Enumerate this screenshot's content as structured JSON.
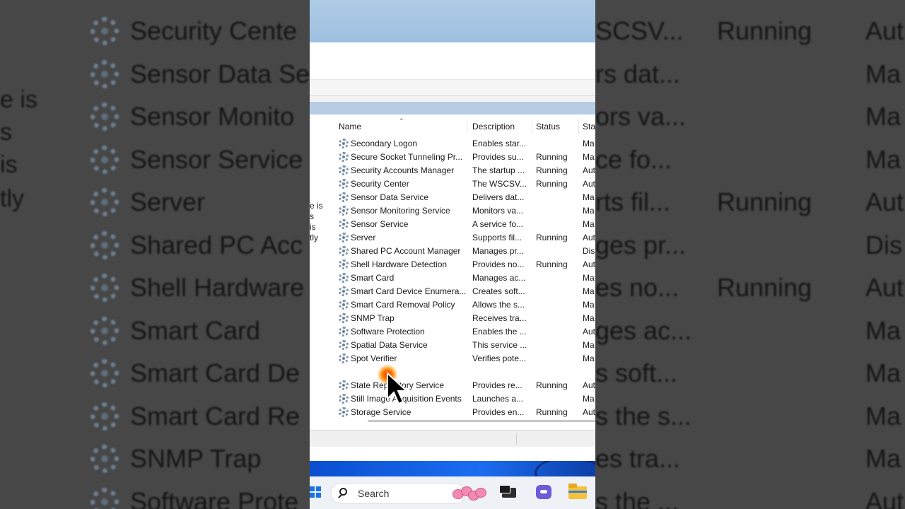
{
  "background": {
    "left_rows": [
      "Security Cente",
      "Sensor Data Se",
      "Sensor Monito",
      "Sensor Service",
      "Server",
      "Shared PC Acc",
      "Shell Hardware",
      "Smart Card",
      "Smart Card De",
      "Smart Card Re",
      "SNMP Trap",
      "Software Prote"
    ],
    "left_cut_texts": [
      "e is",
      "s",
      "is",
      "tly"
    ],
    "right_rows": [
      {
        "desc": "SCSV...",
        "status": "Running",
        "startup": "Aut"
      },
      {
        "desc": "rs dat...",
        "status": "",
        "startup": "Ma"
      },
      {
        "desc": "ors va...",
        "status": "",
        "startup": "Ma"
      },
      {
        "desc": "ce fo...",
        "status": "",
        "startup": "Ma"
      },
      {
        "desc": "rts fil...",
        "status": "Running",
        "startup": "Aut"
      },
      {
        "desc": "ges pr...",
        "status": "",
        "startup": "Dis"
      },
      {
        "desc": "es no...",
        "status": "Running",
        "startup": "Aut"
      },
      {
        "desc": "ges ac...",
        "status": "",
        "startup": "Ma"
      },
      {
        "desc": "s soft...",
        "status": "",
        "startup": "Ma"
      },
      {
        "desc": "s the s...",
        "status": "",
        "startup": "Ma"
      },
      {
        "desc": "es tra...",
        "status": "",
        "startup": "Ma"
      },
      {
        "desc": "s the ...",
        "status": "",
        "startup": "Aut"
      }
    ]
  },
  "left_panel_text": [
    "e is",
    "s",
    "is",
    "tly"
  ],
  "columns": {
    "name": "Name",
    "description": "Description",
    "status": "Status",
    "startup": "Sta"
  },
  "services": [
    {
      "name": "Secondary Logon",
      "description": "Enables star...",
      "status": "",
      "startup": "Ma"
    },
    {
      "name": "Secure Socket Tunneling Pr...",
      "description": "Provides su...",
      "status": "Running",
      "startup": "Ma"
    },
    {
      "name": "Security Accounts Manager",
      "description": "The startup ...",
      "status": "Running",
      "startup": "Aut"
    },
    {
      "name": "Security Center",
      "description": "The WSCSV...",
      "status": "Running",
      "startup": "Aut"
    },
    {
      "name": "Sensor Data Service",
      "description": "Delivers dat...",
      "status": "",
      "startup": "Ma"
    },
    {
      "name": "Sensor Monitoring Service",
      "description": "Monitors va...",
      "status": "",
      "startup": "Ma"
    },
    {
      "name": "Sensor Service",
      "description": "A service fo...",
      "status": "",
      "startup": "Ma"
    },
    {
      "name": "Server",
      "description": "Supports fil...",
      "status": "Running",
      "startup": "Aut"
    },
    {
      "name": "Shared PC Account Manager",
      "description": "Manages pr...",
      "status": "",
      "startup": "Dis"
    },
    {
      "name": "Shell Hardware Detection",
      "description": "Provides no...",
      "status": "Running",
      "startup": "Aut"
    },
    {
      "name": "Smart Card",
      "description": "Manages ac...",
      "status": "",
      "startup": "Ma"
    },
    {
      "name": "Smart Card Device Enumera...",
      "description": "Creates soft...",
      "status": "",
      "startup": "Ma"
    },
    {
      "name": "Smart Card Removal Policy",
      "description": "Allows the s...",
      "status": "",
      "startup": "Ma"
    },
    {
      "name": "SNMP Trap",
      "description": "Receives tra...",
      "status": "",
      "startup": "Ma"
    },
    {
      "name": "Software Protection",
      "description": "Enables the ...",
      "status": "",
      "startup": "Aut"
    },
    {
      "name": "Spatial Data Service",
      "description": "This service ...",
      "status": "",
      "startup": "Ma"
    },
    {
      "name": "Spot Verifier",
      "description": "Verifies pote...",
      "status": "",
      "startup": "Ma"
    },
    {
      "name": "",
      "description": "",
      "status": "",
      "startup": ""
    },
    {
      "name": "State Repository Service",
      "description": "Provides re...",
      "status": "Running",
      "startup": "Aut"
    },
    {
      "name": "Still Image Acquisition Events",
      "description": "Launches a...",
      "status": "",
      "startup": "Ma"
    },
    {
      "name": "Storage Service",
      "description": "Provides en...",
      "status": "Running",
      "startup": "Aut"
    }
  ],
  "taskbar": {
    "search_label": "Search"
  },
  "icons": {
    "service": "gear-icon",
    "start": "windows-start-icon",
    "search": "search-icon",
    "task_view": "task-view-icon",
    "chat": "chat-icon",
    "explorer": "folder-icon",
    "widget": "candy-widget-icon",
    "cursor": "mouse-pointer-icon"
  }
}
